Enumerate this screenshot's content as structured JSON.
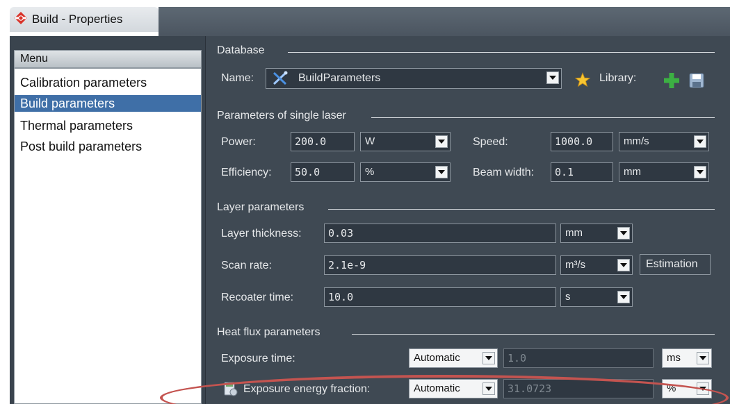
{
  "window": {
    "title": "Build - Properties"
  },
  "sidebar": {
    "header": "Menu",
    "items": [
      {
        "label": "Calibration parameters",
        "selected": false
      },
      {
        "label": "Build parameters",
        "selected": true
      },
      {
        "label": "Thermal parameters",
        "selected": false
      },
      {
        "label": "Post build parameters",
        "selected": false
      }
    ]
  },
  "database": {
    "section": "Database",
    "name_label": "Name:",
    "name_value": "BuildParameters",
    "library_label": "Library:"
  },
  "single_laser": {
    "section": "Parameters of single laser",
    "power": {
      "label": "Power:",
      "value": "200.0",
      "unit": "W"
    },
    "speed": {
      "label": "Speed:",
      "value": "1000.0",
      "unit": "mm/s"
    },
    "efficiency": {
      "label": "Efficiency:",
      "value": "50.0",
      "unit": "%"
    },
    "beam_width": {
      "label": "Beam width:",
      "value": "0.1",
      "unit": "mm"
    }
  },
  "layer": {
    "section": "Layer parameters",
    "thickness": {
      "label": "Layer thickness:",
      "value": "0.03",
      "unit": "mm"
    },
    "scan_rate": {
      "label": "Scan rate:",
      "value": "2.1e-9",
      "unit": "m³/s"
    },
    "recoater": {
      "label": "Recoater time:",
      "value": "10.0",
      "unit": "s"
    },
    "estimation_button": "Estimation"
  },
  "heat_flux": {
    "section": "Heat flux parameters",
    "exposure_time": {
      "label": "Exposure time:",
      "mode": "Automatic",
      "value": "1.0",
      "unit": "ms"
    },
    "exposure_energy": {
      "label": "Exposure energy fraction:",
      "mode": "Automatic",
      "value": "31.0723",
      "unit": "%"
    }
  },
  "colors": {
    "highlight": "#c45450",
    "selected": "#3f6fa7",
    "add": "#3cb043"
  }
}
